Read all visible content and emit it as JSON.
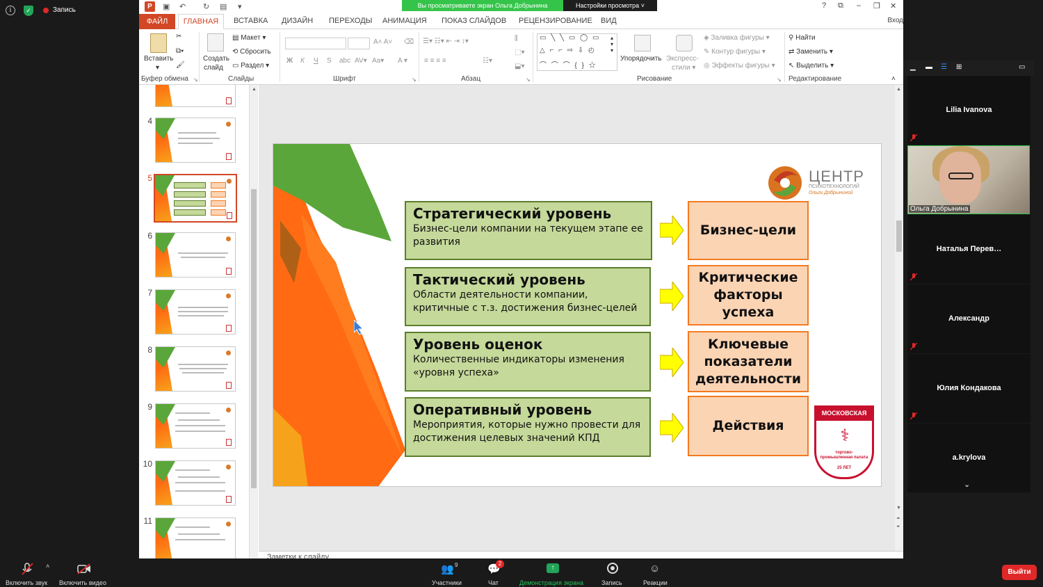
{
  "zoom_top": {
    "info_icon": "info-icon",
    "security_icon": "shield-icon",
    "recording_label": "Запись"
  },
  "ppt": {
    "share_banner": "Вы просматриваете экран Ольга Добрынина",
    "view_settings": "Настройки просмотра",
    "tabs": [
      "ФАЙЛ",
      "ГЛАВНАЯ",
      "ВСТАВКА",
      "ДИЗАЙН",
      "ПЕРЕХОДЫ",
      "АНИМАЦИЯ",
      "ПОКАЗ СЛАЙДОВ",
      "РЕЦЕНЗИРОВАНИЕ",
      "ВИД"
    ],
    "login": "Вход",
    "window_controls": {
      "help": "?",
      "restore": "⧉",
      "minimize": "–",
      "maximize": "❐",
      "close": "✕"
    },
    "ribbon": {
      "paste": "Вставить",
      "clipboard_group": "Буфер обмена",
      "new_slide_1": "Создать",
      "new_slide_2": "слайд",
      "layout": "Макет",
      "reset": "Сбросить",
      "section": "Раздел",
      "slides_group": "Слайды",
      "font_group": "Шрифт",
      "paragraph_group": "Абзац",
      "arrange": "Упорядочить",
      "quick_styles_1": "Экспресс-",
      "quick_styles_2": "стили",
      "shape_fill": "Заливка фигуры",
      "shape_outline": "Контур фигуры",
      "shape_effects": "Эффекты фигуры",
      "drawing_group": "Рисование",
      "find": "Найти",
      "replace": "Заменить",
      "select": "Выделить",
      "editing_group": "Редактирование"
    },
    "thumbnails": [
      {
        "num": "4"
      },
      {
        "num": "5"
      },
      {
        "num": "6"
      },
      {
        "num": "7"
      },
      {
        "num": "8"
      },
      {
        "num": "9"
      },
      {
        "num": "10"
      },
      {
        "num": "11"
      }
    ],
    "notes_placeholder": "Заметки к слайду"
  },
  "slide": {
    "logo_text": "ЦЕНТР",
    "logo_sub1": "ПСИХОТЕХНОЛОГИЙ",
    "logo_sub2": "Ольги Добрыниной",
    "levels": [
      {
        "title": "Стратегический уровень",
        "desc": "Бизнес-цели компании на текущем этапе ее развития"
      },
      {
        "title": "Тактический уровень",
        "desc": "Области деятельности компании, критичные с т.з. достижения бизнес-целей"
      },
      {
        "title": "Уровень оценок",
        "desc": "Количественные индикаторы изменения «уровня успеха»"
      },
      {
        "title": "Оперативный уровень",
        "desc": "Мероприятия, которые нужно провести для достижения целевых значений КПД"
      }
    ],
    "results": [
      "Бизнес-цели",
      "Критические факторы успеха",
      "Ключевые показатели деятельности",
      "Действия"
    ],
    "chamber_title": "МОСКОВСКАЯ",
    "chamber_sub": "торгово-промышленная палата",
    "chamber_years": "25 ЛЕТ",
    "arrow_color": "#ffff00"
  },
  "participants": [
    {
      "name": "Lilia Ivanova"
    },
    {
      "name": "Ольга Добрынина"
    },
    {
      "name": "Наталья  Перев…"
    },
    {
      "name": "Александр"
    },
    {
      "name": "Юлия Кондакова"
    },
    {
      "name": "a.krylova"
    }
  ],
  "zoombar": {
    "mute": "Включить звук",
    "video": "Включить видео",
    "participants": "Участники",
    "participants_count": "9",
    "chat": "Чат",
    "chat_badge": "2",
    "share": "Демонстрация экрана",
    "record": "Запись",
    "reactions": "Реакции",
    "leave": "Выйти"
  }
}
